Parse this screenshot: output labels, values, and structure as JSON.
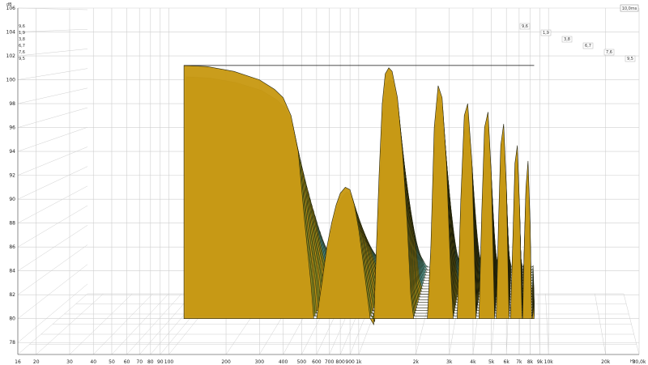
{
  "chart_data": {
    "type": "area",
    "subtype": "waterfall-3d",
    "title": "",
    "xlabel": "",
    "ylabel": "",
    "y_unit": "dB",
    "x_unit_suffix": "Hz",
    "time_unit_label": "10,0ms",
    "ylim": [
      77,
      106
    ],
    "yticks": [
      106,
      104,
      102,
      100,
      98,
      96,
      94,
      92,
      90,
      88,
      86,
      84,
      82,
      80,
      78
    ],
    "xscale": "log",
    "xlim": [
      16,
      30000
    ],
    "xticks": [
      {
        "value": 16,
        "label": "16"
      },
      {
        "value": 20,
        "label": "20"
      },
      {
        "value": 30,
        "label": "30"
      },
      {
        "value": 40,
        "label": "40"
      },
      {
        "value": 50,
        "label": "50"
      },
      {
        "value": 60,
        "label": "60"
      },
      {
        "value": 70,
        "label": "70"
      },
      {
        "value": 80,
        "label": "80"
      },
      {
        "value": 90,
        "label": "90"
      },
      {
        "value": 100,
        "label": "100"
      },
      {
        "value": 200,
        "label": "200"
      },
      {
        "value": 300,
        "label": "300"
      },
      {
        "value": 400,
        "label": "400"
      },
      {
        "value": 500,
        "label": "500"
      },
      {
        "value": 600,
        "label": "600"
      },
      {
        "value": 700,
        "label": "700"
      },
      {
        "value": 800,
        "label": "800"
      },
      {
        "value": 900,
        "label": "900"
      },
      {
        "value": 1000,
        "label": "1k"
      },
      {
        "value": 2000,
        "label": "2k"
      },
      {
        "value": 3000,
        "label": "3k"
      },
      {
        "value": 4000,
        "label": "4k"
      },
      {
        "value": 5000,
        "label": "5k"
      },
      {
        "value": 6000,
        "label": "6k"
      },
      {
        "value": 7000,
        "label": "7k"
      },
      {
        "value": 8000,
        "label": "8k"
      },
      {
        "value": 9000,
        "label": "9k"
      },
      {
        "value": 10000,
        "label": "10k"
      },
      {
        "value": 20000,
        "label": "20k"
      },
      {
        "value": 30000,
        "label": "30,0k"
      }
    ],
    "time_ticks_left": [
      "9,6",
      "1,9",
      "3,8",
      "6,7",
      "7,6",
      "9,5"
    ],
    "time_ticks_right": [
      "9,6",
      "1,9",
      "3,8",
      "6,7",
      "7,6",
      "9,5"
    ],
    "grid": true,
    "colors": {
      "front": "#8f8f24",
      "back": "#4a8f8a",
      "cut": "#c99a15",
      "outline": "#1f1f08",
      "grid": "#cfcfcf"
    },
    "slices": [
      {
        "points": [
          [
            120,
            101.2
          ],
          [
            160,
            101.1
          ],
          [
            220,
            100.7
          ],
          [
            300,
            100.0
          ],
          [
            360,
            99.2
          ],
          [
            400,
            98.5
          ],
          [
            440,
            97.0
          ],
          [
            480,
            94.0
          ],
          [
            520,
            88.0
          ],
          [
            560,
            83.0
          ],
          [
            580,
            80.0
          ],
          [
            600,
            80.0
          ],
          [
            640,
            83.0
          ],
          [
            680,
            86.0
          ],
          [
            720,
            88.0
          ],
          [
            760,
            89.5
          ],
          [
            800,
            90.5
          ],
          [
            850,
            91.0
          ],
          [
            900,
            90.8
          ],
          [
            950,
            89.5
          ],
          [
            1000,
            87.5
          ],
          [
            1050,
            85.0
          ],
          [
            1100,
            82.5
          ],
          [
            1150,
            80.0
          ],
          [
            1200,
            79.5
          ],
          [
            1220,
            83.0
          ],
          [
            1280,
            92.0
          ],
          [
            1330,
            98.0
          ],
          [
            1380,
            100.5
          ],
          [
            1440,
            101.0
          ],
          [
            1500,
            100.7
          ],
          [
            1600,
            98.5
          ],
          [
            1700,
            94.0
          ],
          [
            1800,
            88.0
          ],
          [
            1880,
            82.0
          ],
          [
            1950,
            80.0
          ],
          [
            2300,
            80.0
          ],
          [
            2400,
            86.0
          ],
          [
            2500,
            96.0
          ],
          [
            2620,
            99.5
          ],
          [
            2750,
            98.5
          ],
          [
            2900,
            93.0
          ],
          [
            3050,
            84.0
          ],
          [
            3150,
            80.0
          ],
          [
            3300,
            80.0
          ],
          [
            3450,
            90.0
          ],
          [
            3600,
            97.0
          ],
          [
            3750,
            98.0
          ],
          [
            3950,
            93.0
          ],
          [
            4150,
            80.0
          ],
          [
            4300,
            80.0
          ],
          [
            4450,
            89.0
          ],
          [
            4600,
            96.0
          ],
          [
            4800,
            97.3
          ],
          [
            5000,
            92.0
          ],
          [
            5200,
            80.0
          ],
          [
            5300,
            80.0
          ],
          [
            5450,
            88.0
          ],
          [
            5600,
            94.5
          ],
          [
            5800,
            96.3
          ],
          [
            6000,
            91.0
          ],
          [
            6200,
            80.0
          ],
          [
            6300,
            80.0
          ],
          [
            6500,
            87.0
          ],
          [
            6650,
            93.0
          ],
          [
            6850,
            94.5
          ],
          [
            7050,
            89.0
          ],
          [
            7250,
            80.0
          ],
          [
            7300,
            80.0
          ],
          [
            7450,
            86.0
          ],
          [
            7600,
            91.0
          ],
          [
            7800,
            93.2
          ],
          [
            8000,
            88.0
          ],
          [
            8150,
            80.0
          ],
          [
            8200,
            80.0
          ],
          [
            8300,
            80.5
          ],
          [
            8400,
            81.5
          ]
        ]
      }
    ]
  }
}
